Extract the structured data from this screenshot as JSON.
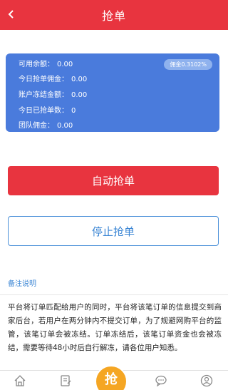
{
  "header": {
    "title": "抢单",
    "back_icon": "chevron-left-icon"
  },
  "stats": {
    "commission_badge": "佣金0.3102%",
    "rows": [
      {
        "label": "可用余额：",
        "value": "0.00"
      },
      {
        "label": "今日抢单佣金：",
        "value": "0.00"
      },
      {
        "label": "账户冻结金额：",
        "value": "0.00"
      },
      {
        "label": "今日已抢单数：",
        "value": "0"
      },
      {
        "label": "团队佣金：",
        "value": "0.00"
      }
    ]
  },
  "buttons": {
    "auto_grab": "自动抢单",
    "stop_grab": "停止抢单"
  },
  "remark": {
    "title": "备注说明",
    "text": "平台将订单匹配给用户的同时，平台将该笔订单的信息提交到商家后台，若用户在两分钟内不提交订单，为了规避网购平台的监管，该笔订单会被冻结。订单冻结后，该笔订单资金也会被冻结，需要等待48小时后自行解冻，请各位用户知悉。"
  },
  "tabbar": {
    "center_label": "抢",
    "icons": [
      "home-icon",
      "order-icon",
      "chat-icon",
      "profile-icon"
    ]
  },
  "colors": {
    "accent_red": "#e8343f",
    "card_blue": "#4a7bdc",
    "link_blue": "#3a85d4",
    "fab_orange": "#f5a623"
  }
}
